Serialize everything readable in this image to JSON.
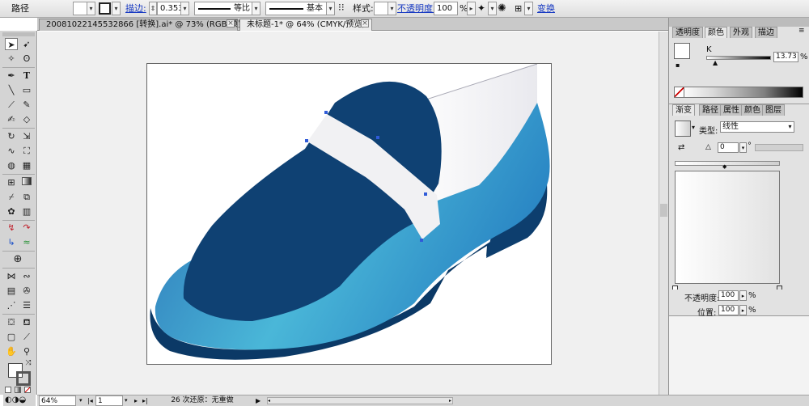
{
  "control_bar": {
    "object_type": "路径",
    "stroke_label": "描边:",
    "stroke_value": "0.353",
    "stroke_unit_label": "等比",
    "brush_label": "基本",
    "style_label": "样式:",
    "opacity_label": "不透明度:",
    "opacity_value": "100",
    "opacity_unit": "%",
    "transform_label": "变换"
  },
  "tabs": [
    {
      "title": "20081022145532866 [转换].ai* @ 73% (RGB/预览)",
      "active": false
    },
    {
      "title": "未标题-1* @ 64% (CMYK/预览)",
      "active": true
    }
  ],
  "tools_icons": [
    "selection-icon",
    "direct-selection-icon",
    "magic-wand-icon",
    "lasso-icon",
    "pen-icon",
    "type-icon",
    "line-icon",
    "rectangle-icon",
    "paintbrush-icon",
    "pencil-icon",
    "blob-brush-icon",
    "eraser-icon",
    "rotate-icon",
    "scale-icon",
    "warp-icon",
    "free-transform-icon",
    "shape-builder-icon",
    "perspective-icon",
    "mesh-icon",
    "gradient-icon",
    "eyedropper-icon",
    "blend-icon",
    "symbol-sprayer-icon",
    "column-graph-icon",
    "artboard-icon",
    "slice-icon",
    "hand-icon",
    "zoom-icon"
  ],
  "colors": {
    "shoe_dark": "#0f4173",
    "shoe_sole": "#0b3966",
    "shoe_light": "#2a7fc0",
    "shoe_highlight": "#59c3dd",
    "strap": "#f1f1f3",
    "accent_link": "#1739c2"
  },
  "right_panel": {
    "top_tabs": [
      "透明度",
      "颜色",
      "外观",
      "描边"
    ],
    "k_label": "K",
    "k_value": "13.73",
    "k_unit": "%",
    "gradient_tabs": [
      "渐变",
      "路径",
      "属性",
      "颜色",
      "图层"
    ],
    "type_label": "类型:",
    "type_value": "线性",
    "angle_value": "0",
    "angle_unit": "°",
    "opacity_label": "不透明度:",
    "opacity_value": "100",
    "opacity_unit": "%",
    "location_label": "位置:",
    "location_value": "100",
    "location_unit": "%"
  },
  "status_bar": {
    "zoom": "64%",
    "artboard_num": "1",
    "undo_status": "26 次还原：无重做"
  }
}
